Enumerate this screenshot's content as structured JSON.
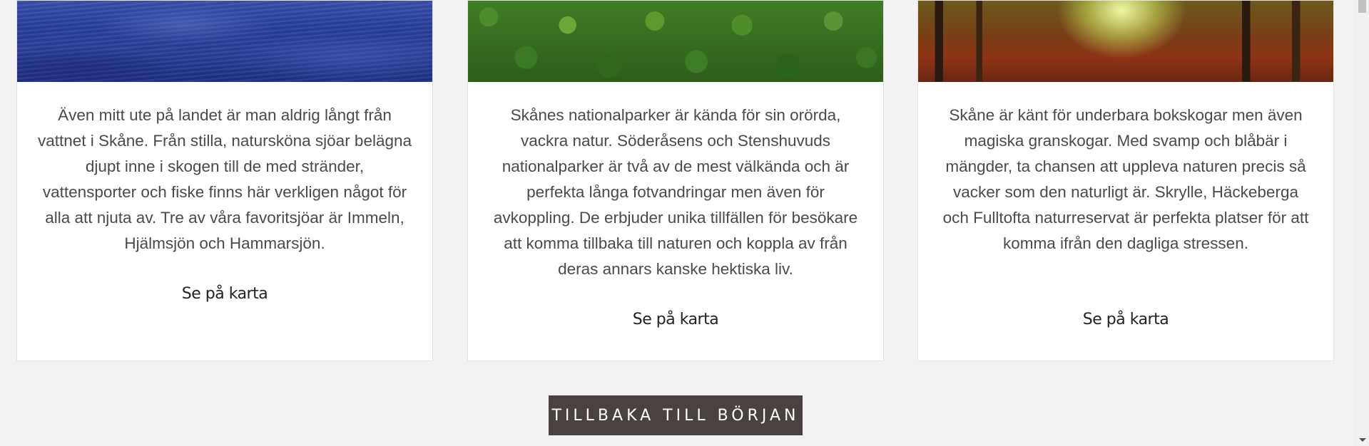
{
  "cards": [
    {
      "image": "lake-water-image",
      "text": "Även mitt ute på landet är man aldrig långt från vattnet i Skåne. Från stilla, natursköna sjöar belägna djupt inne i skogen till de med stränder, vattensporter och fiske finns här verkligen något för alla att njuta av. Tre av våra favoritsjöar är Immeln, Hjälmsjön och Hammarsjön.",
      "link": "Se på karta"
    },
    {
      "image": "forest-canopy-image",
      "text": "Skånes nationalparker är kända för sin orörda, vackra natur. Söderåsens och Stenshuvuds nationalparker är två av de mest välkända och är perfekta långa fotvandringar men även för avkoppling. De erbjuder unika tillfällen för besökare att komma tillbaka till naturen och koppla av från deras annars kanske hektiska liv.",
      "link": "Se på karta"
    },
    {
      "image": "beech-forest-path-image",
      "text": "Skåne är känt för underbara bokskogar men även magiska granskogar. Med svamp och blåbär i mängder, ta chansen att uppleva naturen precis så vacker som den naturligt är. Skrylle, Häckeberga och Fulltofta naturreservat är perfekta platser för att komma ifrån den dagliga stressen.",
      "link": "Se på karta"
    }
  ],
  "back_button": {
    "label": "TILLBAKA TILL BÖRJAN"
  },
  "colors": {
    "button_bg": "#4a4241",
    "page_bg": "#f2f2f2",
    "text": "#4a4a4a"
  }
}
